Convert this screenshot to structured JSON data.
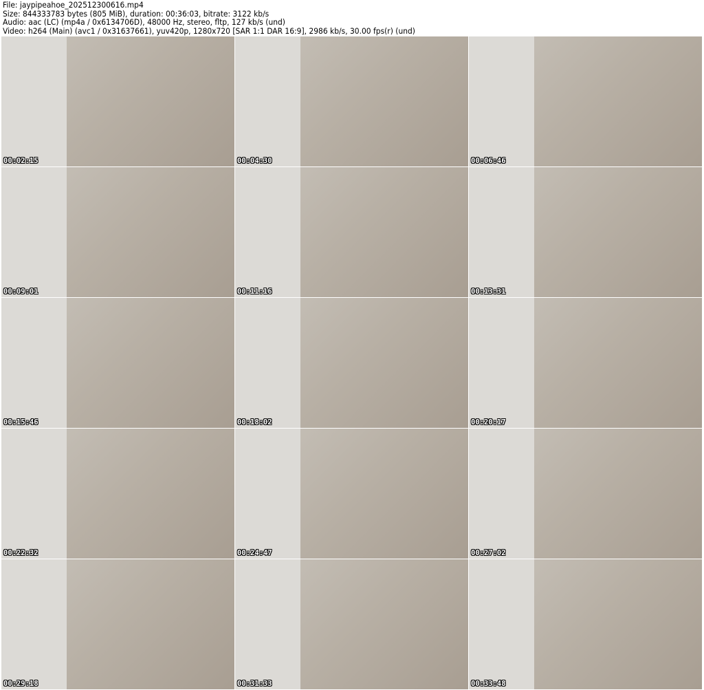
{
  "header": {
    "file": "File: jaypipeahoe_202512300616.mp4",
    "size": "Size: 844333783 bytes (805 MiB), duration: 00:36:03, bitrate: 3122 kb/s",
    "audio": "Audio: aac (LC) (mp4a / 0x6134706D), 48000 Hz, stereo, fltp, 127 kb/s (und)",
    "video": "Video: h264 (Main) (avc1 / 0x31637661), yuv420p, 1280x720 [SAR 1:1 DAR 16:9], 2986 kb/s, 30.00 fps(r) (und)"
  },
  "thumbnails": [
    {
      "timestamp": "00:02:15"
    },
    {
      "timestamp": "00:04:30"
    },
    {
      "timestamp": "00:06:46"
    },
    {
      "timestamp": "00:09:01"
    },
    {
      "timestamp": "00:11:16"
    },
    {
      "timestamp": "00:13:31"
    },
    {
      "timestamp": "00:15:46"
    },
    {
      "timestamp": "00:18:02"
    },
    {
      "timestamp": "00:20:17"
    },
    {
      "timestamp": "00:22:32"
    },
    {
      "timestamp": "00:24:47"
    },
    {
      "timestamp": "00:27:02"
    },
    {
      "timestamp": "00:29:18"
    },
    {
      "timestamp": "00:31:33"
    },
    {
      "timestamp": "00:33:48"
    }
  ]
}
